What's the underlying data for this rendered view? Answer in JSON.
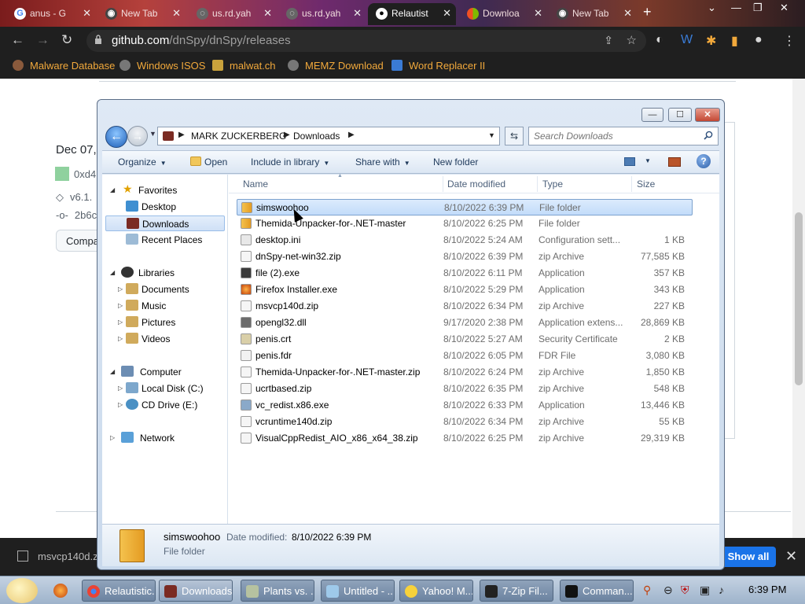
{
  "browser": {
    "tabs": [
      {
        "label": "anus - G",
        "active": false
      },
      {
        "label": "New Tab",
        "active": false
      },
      {
        "label": "us.rd.yah",
        "active": false
      },
      {
        "label": "us.rd.yah",
        "active": false
      },
      {
        "label": "Relautist",
        "active": true
      },
      {
        "label": "Downloa",
        "active": false
      },
      {
        "label": "New Tab",
        "active": false
      }
    ],
    "url_host": "github.com",
    "url_path": "/dnSpy/dnSpy/releases",
    "bookmarks": [
      "Malware Database",
      "Windows ISOS",
      "malwat.ch",
      "MEMZ Download",
      "Word Replacer II"
    ]
  },
  "github_page": {
    "date": "Dec 07,",
    "sha": "0xd4",
    "tag": "v6.1.",
    "commit": "2b6c",
    "compare_label": "Compa"
  },
  "explorer": {
    "breadcrumb": [
      "MARK ZUCKERBERG",
      "Downloads"
    ],
    "search_placeholder": "Search Downloads",
    "commands": {
      "organize": "Organize",
      "open": "Open",
      "include_in_library": "Include in library",
      "share_with": "Share with",
      "new_folder": "New folder"
    },
    "nav": {
      "favorites": "Favorites",
      "desktop": "Desktop",
      "downloads": "Downloads",
      "recent_places": "Recent Places",
      "libraries": "Libraries",
      "documents": "Documents",
      "music": "Music",
      "pictures": "Pictures",
      "videos": "Videos",
      "computer": "Computer",
      "local_disk": "Local Disk (C:)",
      "cd_drive": "CD Drive (E:)",
      "network": "Network"
    },
    "columns": {
      "name": "Name",
      "date": "Date modified",
      "type": "Type",
      "size": "Size"
    },
    "files": [
      {
        "name": "simswoohoo",
        "date": "8/10/2022 6:39 PM",
        "type": "File folder",
        "size": "",
        "icon": "folder-icon",
        "selected": true
      },
      {
        "name": "Themida-Unpacker-for-.NET-master",
        "date": "8/10/2022 6:25 PM",
        "type": "File folder",
        "size": "",
        "icon": "folder-icon"
      },
      {
        "name": "desktop.ini",
        "date": "8/10/2022 5:24 AM",
        "type": "Configuration sett...",
        "size": "1 KB",
        "icon": "settings-file-icon"
      },
      {
        "name": "dnSpy-net-win32.zip",
        "date": "8/10/2022 6:39 PM",
        "type": "zip Archive",
        "size": "77,585 KB",
        "icon": "zip-icon"
      },
      {
        "name": "file (2).exe",
        "date": "8/10/2022 6:11 PM",
        "type": "Application",
        "size": "357 KB",
        "icon": "exe-icon"
      },
      {
        "name": "Firefox Installer.exe",
        "date": "8/10/2022 5:29 PM",
        "type": "Application",
        "size": "343 KB",
        "icon": "firefox-icon"
      },
      {
        "name": "msvcp140d.zip",
        "date": "8/10/2022 6:34 PM",
        "type": "zip Archive",
        "size": "227 KB",
        "icon": "zip-icon"
      },
      {
        "name": "opengl32.dll",
        "date": "9/17/2020 2:38 PM",
        "type": "Application extens...",
        "size": "28,869 KB",
        "icon": "dll-icon"
      },
      {
        "name": "penis.crt",
        "date": "8/10/2022 5:27 AM",
        "type": "Security Certificate",
        "size": "2 KB",
        "icon": "certificate-icon"
      },
      {
        "name": "penis.fdr",
        "date": "8/10/2022 6:05 PM",
        "type": "FDR File",
        "size": "3,080 KB",
        "icon": "file-icon"
      },
      {
        "name": "Themida-Unpacker-for-.NET-master.zip",
        "date": "8/10/2022 6:24 PM",
        "type": "zip Archive",
        "size": "1,850 KB",
        "icon": "zip-icon"
      },
      {
        "name": "ucrtbased.zip",
        "date": "8/10/2022 6:35 PM",
        "type": "zip Archive",
        "size": "548 KB",
        "icon": "zip-icon"
      },
      {
        "name": "vc_redist.x86.exe",
        "date": "8/10/2022 6:33 PM",
        "type": "Application",
        "size": "13,446 KB",
        "icon": "installer-icon"
      },
      {
        "name": "vcruntime140d.zip",
        "date": "8/10/2022 6:34 PM",
        "type": "zip Archive",
        "size": "55 KB",
        "icon": "zip-icon"
      },
      {
        "name": "VisualCppRedist_AIO_x86_x64_38.zip",
        "date": "8/10/2022 6:25 PM",
        "type": "zip Archive",
        "size": "29,319 KB",
        "icon": "zip-icon"
      }
    ],
    "details": {
      "name": "simswoohoo",
      "modified_label": "Date modified:",
      "modified": "8/10/2022 6:39 PM",
      "type": "File folder"
    }
  },
  "download_bar": {
    "item": "msvcp140d.z",
    "show_all": "Show all"
  },
  "taskbar": {
    "tasks": [
      "Relautistic...",
      "Downloads",
      "Plants vs. ...",
      "Untitled - ...",
      "Yahoo! M...",
      "7-Zip Fil...",
      "Comman..."
    ],
    "clock": "6:39 PM"
  },
  "colors": {
    "chrome_dark": "#1f1f1f",
    "bookmark_text": "#f2a93b",
    "selection": "#cfe2fa",
    "show_all_blue": "#1a73e8"
  }
}
